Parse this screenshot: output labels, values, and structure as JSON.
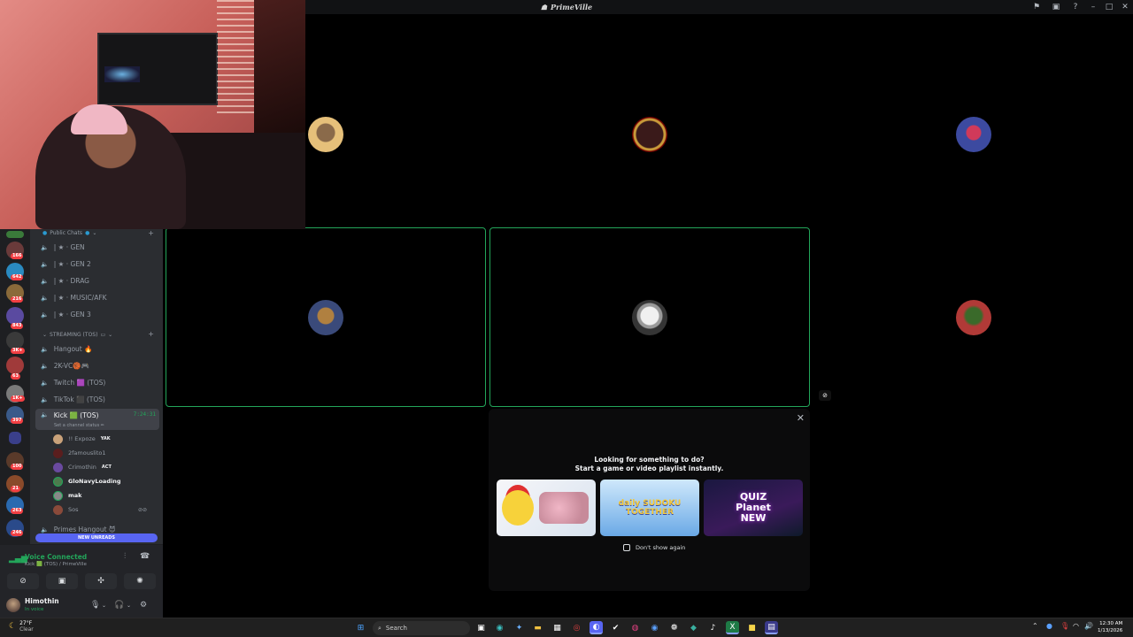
{
  "window": {
    "title": "PrimeVille"
  },
  "server": {
    "categories": [
      {
        "label": "Public Chats"
      },
      {
        "label": "STREAMING (TOS)"
      }
    ],
    "public_channels": [
      {
        "label": "| ★ · GEN"
      },
      {
        "label": "| ★ · GEN 2"
      },
      {
        "label": "| ★ · DRAG"
      },
      {
        "label": "| ★ · MUSIC/AFK"
      },
      {
        "label": "| ★ · GEN 3"
      }
    ],
    "streaming_channels": [
      {
        "label": "Hangout 🔥"
      },
      {
        "label": "2K-VC🏀🎮"
      },
      {
        "label": "Twitch 🟪 (TOS)"
      },
      {
        "label": "TikTok ⬛ (TOS)"
      }
    ],
    "active_channel": {
      "label": "Kick 🟩 (TOS)",
      "timer": "7:24:31",
      "status": "Set a channel status ✏"
    },
    "members": [
      {
        "name": "!! Expoze",
        "tag": "YAK",
        "color": "#c9a27a"
      },
      {
        "name": "2famouslito1",
        "tag": "",
        "color": "#5a1e1e"
      },
      {
        "name": "Crimothin",
        "tag": "ACT",
        "color": "#6a4aa0"
      },
      {
        "name": "GloNavyLoading",
        "tag": "",
        "color": "#4d7a4d"
      },
      {
        "name": "mak",
        "tag": "",
        "color": "#888888"
      },
      {
        "name": "Sos",
        "tag": "",
        "color": "#8a4a3a"
      }
    ],
    "next_channel": {
      "label": "Primes Hangout 😈"
    },
    "new_unreads": "NEW UNREADS",
    "guild_badges": [
      "166",
      "642",
      "216",
      "843",
      "3K+",
      "63",
      "1K+",
      "397",
      "100",
      "21",
      "263",
      "246"
    ]
  },
  "voice": {
    "status": "Voice Connected",
    "location": "Kick 🟩 (TOS) / PrimeVille"
  },
  "user": {
    "name": "Himothin",
    "status": "In voice"
  },
  "stage": {
    "tiles": [
      {
        "color": "#c4a177",
        "speaking": false
      },
      {
        "color": "#720000",
        "speaking": false
      },
      {
        "color": "#3c1f59",
        "speaking": false
      },
      {
        "color": "#353535",
        "speaking": true
      },
      {
        "color": "#353535",
        "speaking": true
      },
      {
        "color": "#b13a37",
        "speaking": false
      }
    ]
  },
  "popup": {
    "heading": "Looking for something to do?",
    "subheading": "Start a game or video playlist instantly.",
    "activities": [
      {
        "name": "",
        "color": "#e9eef5"
      },
      {
        "name": "daily SUDOKU TOGETHER",
        "color": "#7ab8e8"
      },
      {
        "name": "QUIZ Planet NEW",
        "color": "#1c1a3a"
      }
    ],
    "checkbox_label": "Don't show again"
  },
  "taskbar": {
    "weather_temp": "27°F",
    "weather_desc": "Clear",
    "search_placeholder": "Search",
    "time": "12:30 AM",
    "date": "1/13/2026"
  },
  "colors": {
    "accent": "#5865f2",
    "connected": "#23a55a",
    "danger": "#f23f43"
  }
}
